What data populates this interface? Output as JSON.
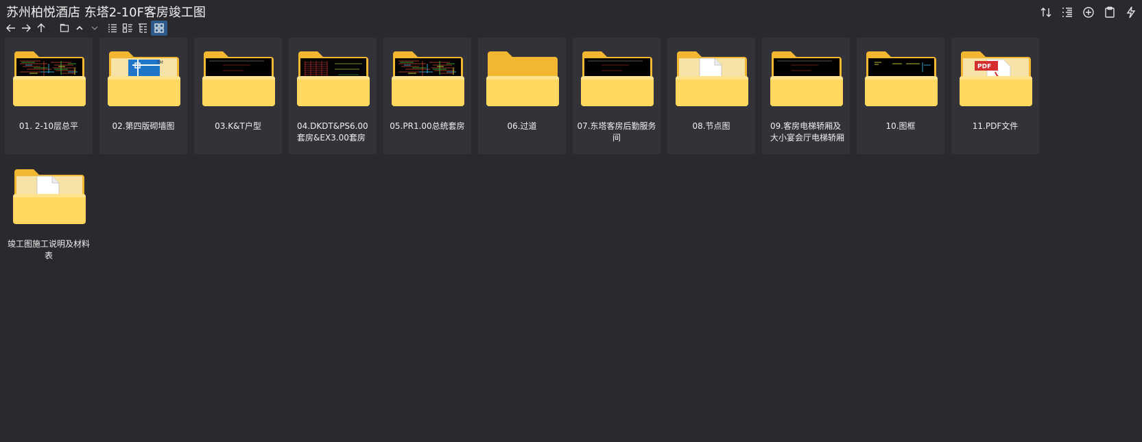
{
  "window": {
    "title": "苏州柏悦酒店 东塔2-10F客房竣工图"
  },
  "toolbar": {
    "icons": [
      "back-arrow-icon",
      "forward-arrow-icon",
      "up-arrow-icon",
      "folder-icon",
      "chevron-up-icon",
      "chevron-down-icon",
      "list-view-icon",
      "details-view-icon",
      "tree-view-icon",
      "grid-view-icon"
    ],
    "active_view": "grid-view-icon"
  },
  "top_actions": {
    "icons": [
      "sort-icon",
      "list-filter-icon",
      "add-circle-icon",
      "clipboard-icon",
      "flash-icon"
    ]
  },
  "colors": {
    "background": "#2a292e",
    "folder_back": "#f2b631",
    "folder_front": "#ffd85f",
    "accent": "#2d5b8a"
  },
  "items": [
    {
      "label": "01. 2-10层总平",
      "preview": "cad-colorful"
    },
    {
      "label": "02.第四版砌墙图",
      "preview": "blue-app"
    },
    {
      "label": "03.K&T户型",
      "preview": "cad-dark"
    },
    {
      "label": "04.DKDT&PS6.00套房&EX3.00套房",
      "preview": "cad-red"
    },
    {
      "label": "05.PR1.00总统套房",
      "preview": "cad-colorful"
    },
    {
      "label": "06.过道",
      "preview": "empty"
    },
    {
      "label": "07.东塔客房后勤服务间",
      "preview": "cad-dark"
    },
    {
      "label": "08.节点图",
      "preview": "blank-doc"
    },
    {
      "label": "09.客房电梯轿厢及大小宴会厅电梯轿厢",
      "preview": "cad-dark"
    },
    {
      "label": "10.图框",
      "preview": "cad-sparse"
    },
    {
      "label": "11.PDF文件",
      "preview": "pdf"
    },
    {
      "label": "竣工图施工说明及材料表",
      "preview": "blank-doc"
    }
  ]
}
